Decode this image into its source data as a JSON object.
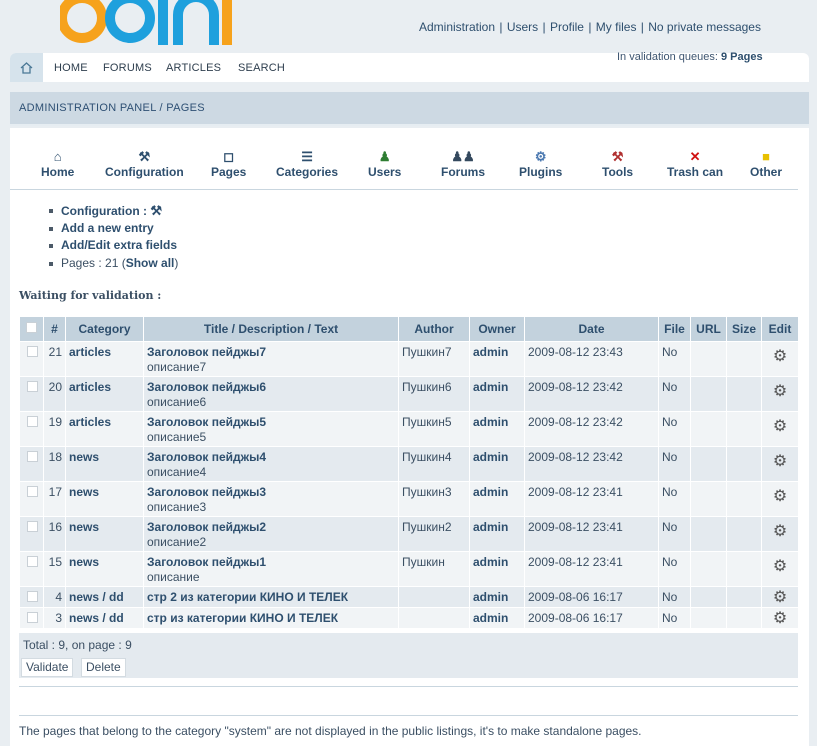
{
  "header": {
    "logo_text": "cotonti",
    "links": [
      "Administration",
      "Users",
      "Profile",
      "My files",
      "No private messages"
    ]
  },
  "navbar": {
    "home_icon": "house-icon",
    "items": [
      "HOME",
      "FORUMS",
      "ARTICLES",
      "SEARCH"
    ],
    "queue_label": "In validation queues:",
    "queue_value": "9 Pages"
  },
  "breadcrumb": "ADMINISTRATION PANEL / PAGES",
  "iconbar": [
    {
      "label": "Home",
      "icon": "house-icon"
    },
    {
      "label": "Configuration",
      "icon": "hammer-icon"
    },
    {
      "label": "Pages",
      "icon": "page-icon"
    },
    {
      "label": "Categories",
      "icon": "tree-icon"
    },
    {
      "label": "Users",
      "icon": "user-icon"
    },
    {
      "label": "Forums",
      "icon": "users-icon"
    },
    {
      "label": "Plugins",
      "icon": "plug-icon"
    },
    {
      "label": "Tools",
      "icon": "tools-icon"
    },
    {
      "label": "Trash can",
      "icon": "cross-icon"
    },
    {
      "label": "Other",
      "icon": "folder-icon"
    }
  ],
  "links": {
    "configuration": "Configuration :",
    "add_entry": "Add a new entry",
    "extra_fields": "Add/Edit extra fields",
    "pages_prefix": "Pages : 21 (",
    "show_all": "Show all",
    "pages_suffix": ")"
  },
  "waiting_label": "Waiting for validation :",
  "table": {
    "headers": [
      "#",
      "Category",
      "Title / Description / Text",
      "Author",
      "Owner",
      "Date",
      "File",
      "URL",
      "Size",
      "Edit"
    ],
    "rows": [
      {
        "id": "21",
        "category": "articles",
        "title": "Заголовок пейджы7",
        "desc": "описание7",
        "author": "Пушкин7",
        "owner": "admin",
        "date": "2009-08-12 23:43",
        "file": "No"
      },
      {
        "id": "20",
        "category": "articles",
        "title": "Заголовок пейджы6",
        "desc": "описание6",
        "author": "Пушкин6",
        "owner": "admin",
        "date": "2009-08-12 23:42",
        "file": "No"
      },
      {
        "id": "19",
        "category": "articles",
        "title": "Заголовок пейджы5",
        "desc": "описание5",
        "author": "Пушкин5",
        "owner": "admin",
        "date": "2009-08-12 23:42",
        "file": "No"
      },
      {
        "id": "18",
        "category": "news",
        "title": "Заголовок пейджы4",
        "desc": "описание4",
        "author": "Пушкин4",
        "owner": "admin",
        "date": "2009-08-12 23:42",
        "file": "No"
      },
      {
        "id": "17",
        "category": "news",
        "title": "Заголовок пейджы3",
        "desc": "описание3",
        "author": "Пушкин3",
        "owner": "admin",
        "date": "2009-08-12 23:41",
        "file": "No"
      },
      {
        "id": "16",
        "category": "news",
        "title": "Заголовок пейджы2",
        "desc": "описание2",
        "author": "Пушкин2",
        "owner": "admin",
        "date": "2009-08-12 23:41",
        "file": "No"
      },
      {
        "id": "15",
        "category": "news",
        "title": "Заголовок пейджы1",
        "desc": "описание",
        "author": "Пушкин",
        "owner": "admin",
        "date": "2009-08-12 23:41",
        "file": "No"
      },
      {
        "id": "4",
        "category": "news / dd",
        "title": "стр 2 из категории КИНО И ТЕЛЕК",
        "desc": "",
        "author": "",
        "owner": "admin",
        "date": "2009-08-06 16:17",
        "file": "No"
      },
      {
        "id": "3",
        "category": "news / dd",
        "title": "стр из категории КИНО И ТЕЛЕК",
        "desc": "",
        "author": "",
        "owner": "admin",
        "date": "2009-08-06 16:17",
        "file": "No"
      }
    ]
  },
  "total": "Total : 9, on page : 9",
  "buttons": {
    "validate": "Validate",
    "delete": "Delete"
  },
  "footnote": "The pages that belong to the category \"system\" are not displayed in the public listings, it's to make standalone pages."
}
